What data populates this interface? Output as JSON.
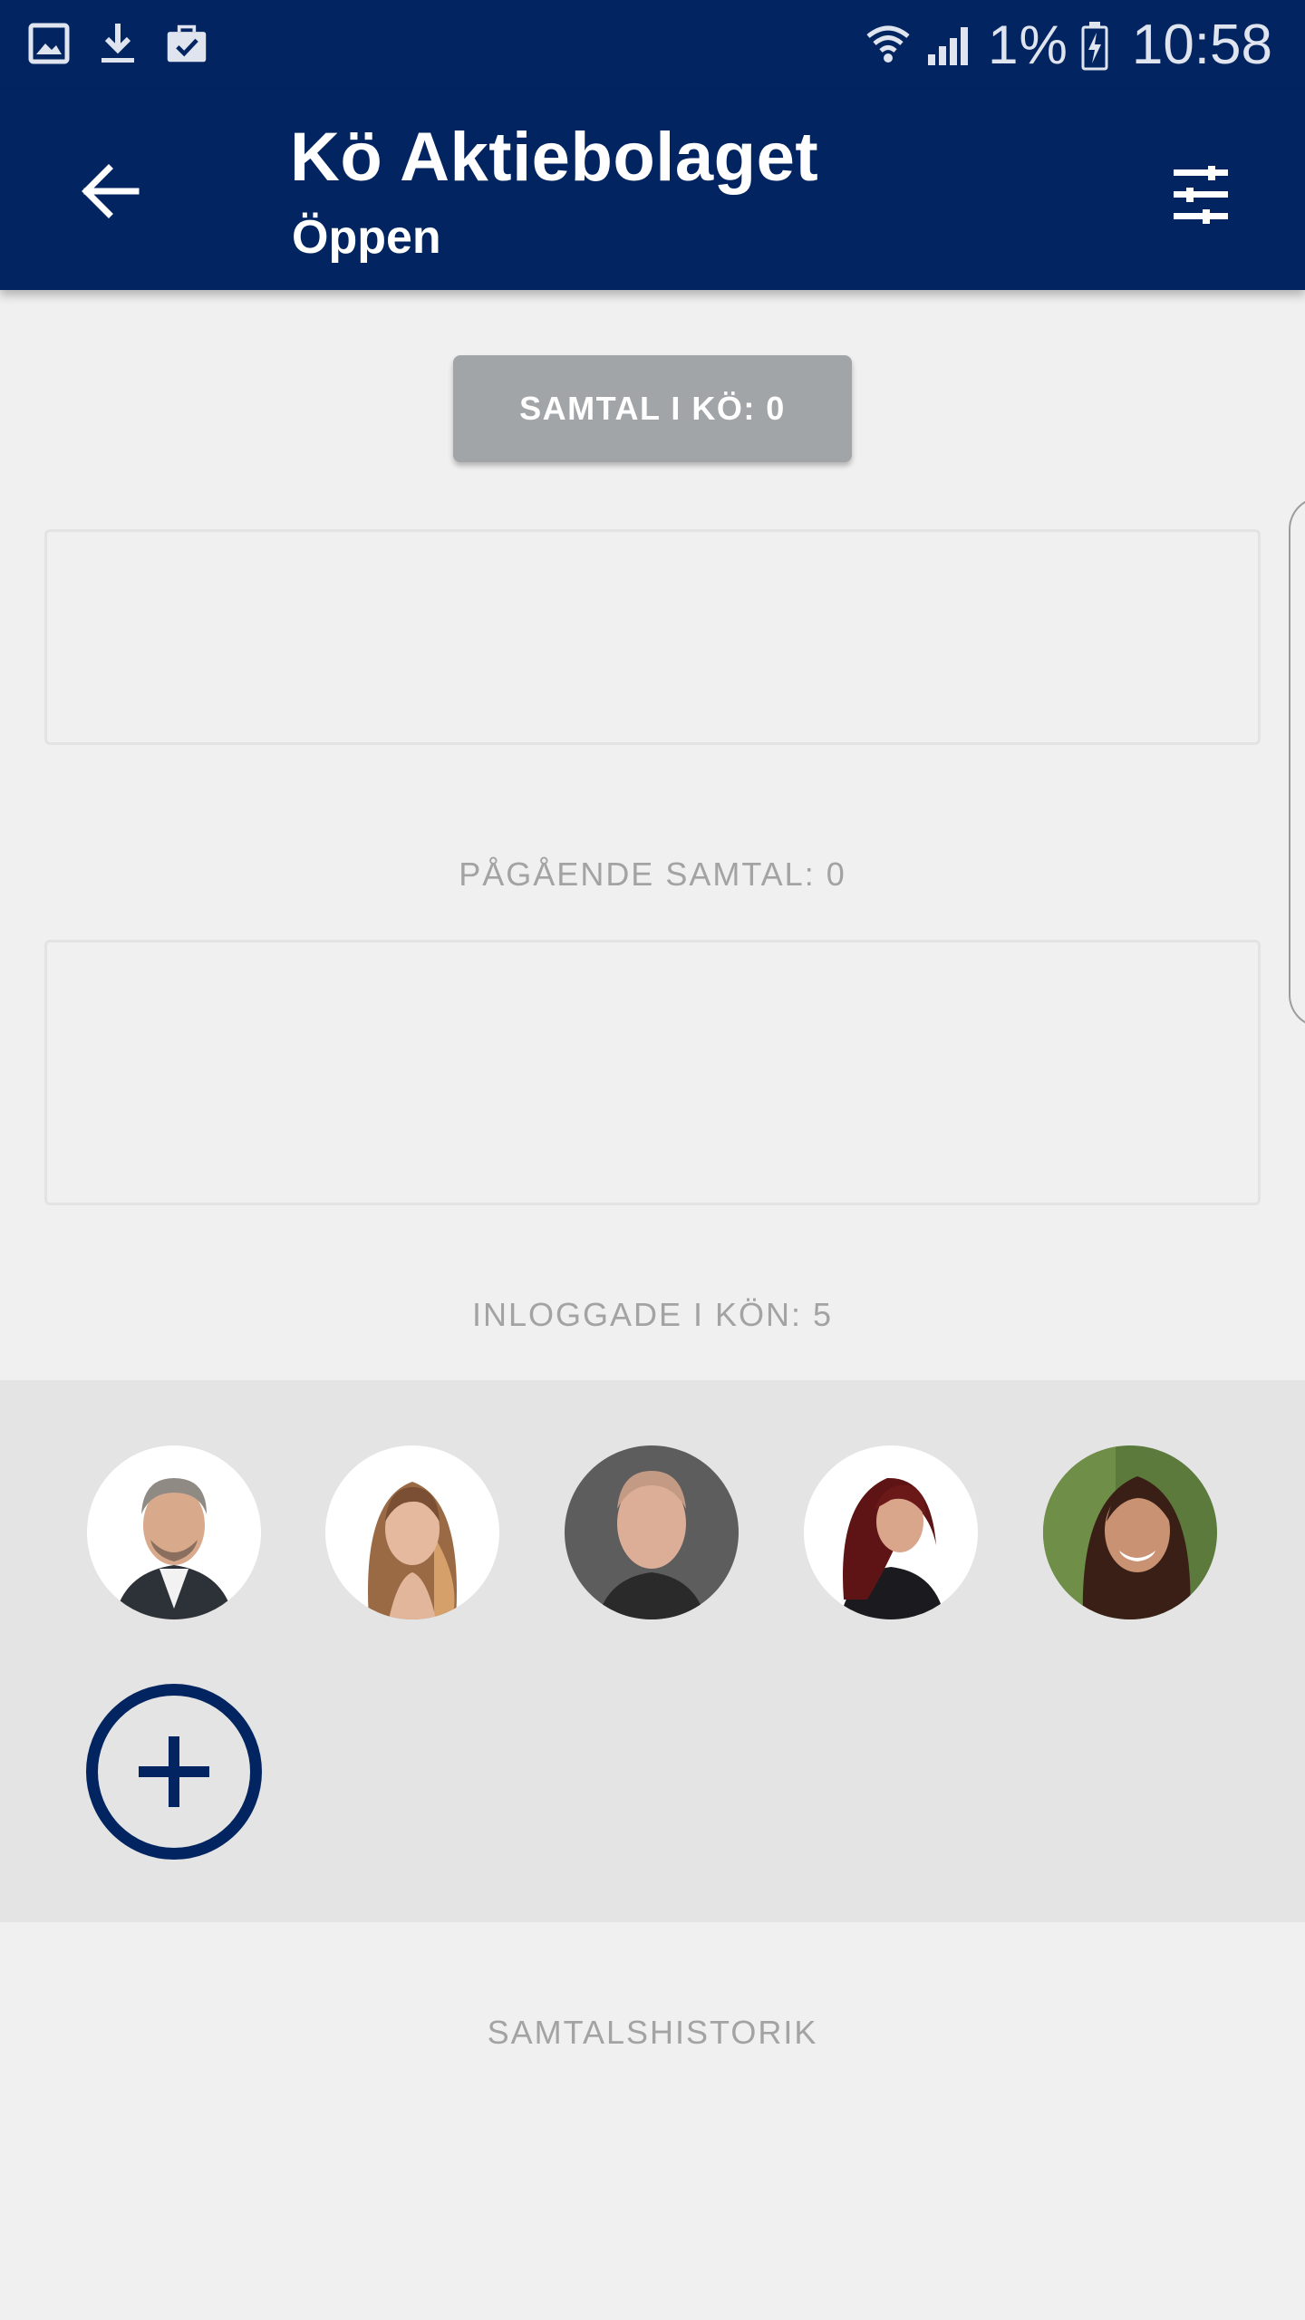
{
  "status_bar": {
    "battery_text": "1%",
    "time": "10:58",
    "icons": [
      "gallery-icon",
      "download-icon",
      "briefcase-check-icon",
      "wifi-icon",
      "signal-icon",
      "battery-charging-icon"
    ]
  },
  "app_bar": {
    "title": "Kö Aktiebolaget",
    "subtitle": "Öppen",
    "back_icon": "arrow-back-icon",
    "filter_icon": "tune-icon"
  },
  "queue_button": {
    "label": "SAMTAL I KÖ: 0"
  },
  "sections": {
    "ongoing_label": "PÅGÅENDE SAMTAL: 0",
    "logged_in_label": "INLOGGADE I KÖN: 5",
    "history_label": "SAMTALSHISTORIK"
  },
  "agents": {
    "count": 5,
    "add_icon": "plus-icon"
  },
  "colors": {
    "primary": "#022562",
    "background": "#f0f0f0",
    "panel": "#e4e4e4",
    "button_gray": "#a2a5a8",
    "label_gray": "#a3a3a3"
  }
}
